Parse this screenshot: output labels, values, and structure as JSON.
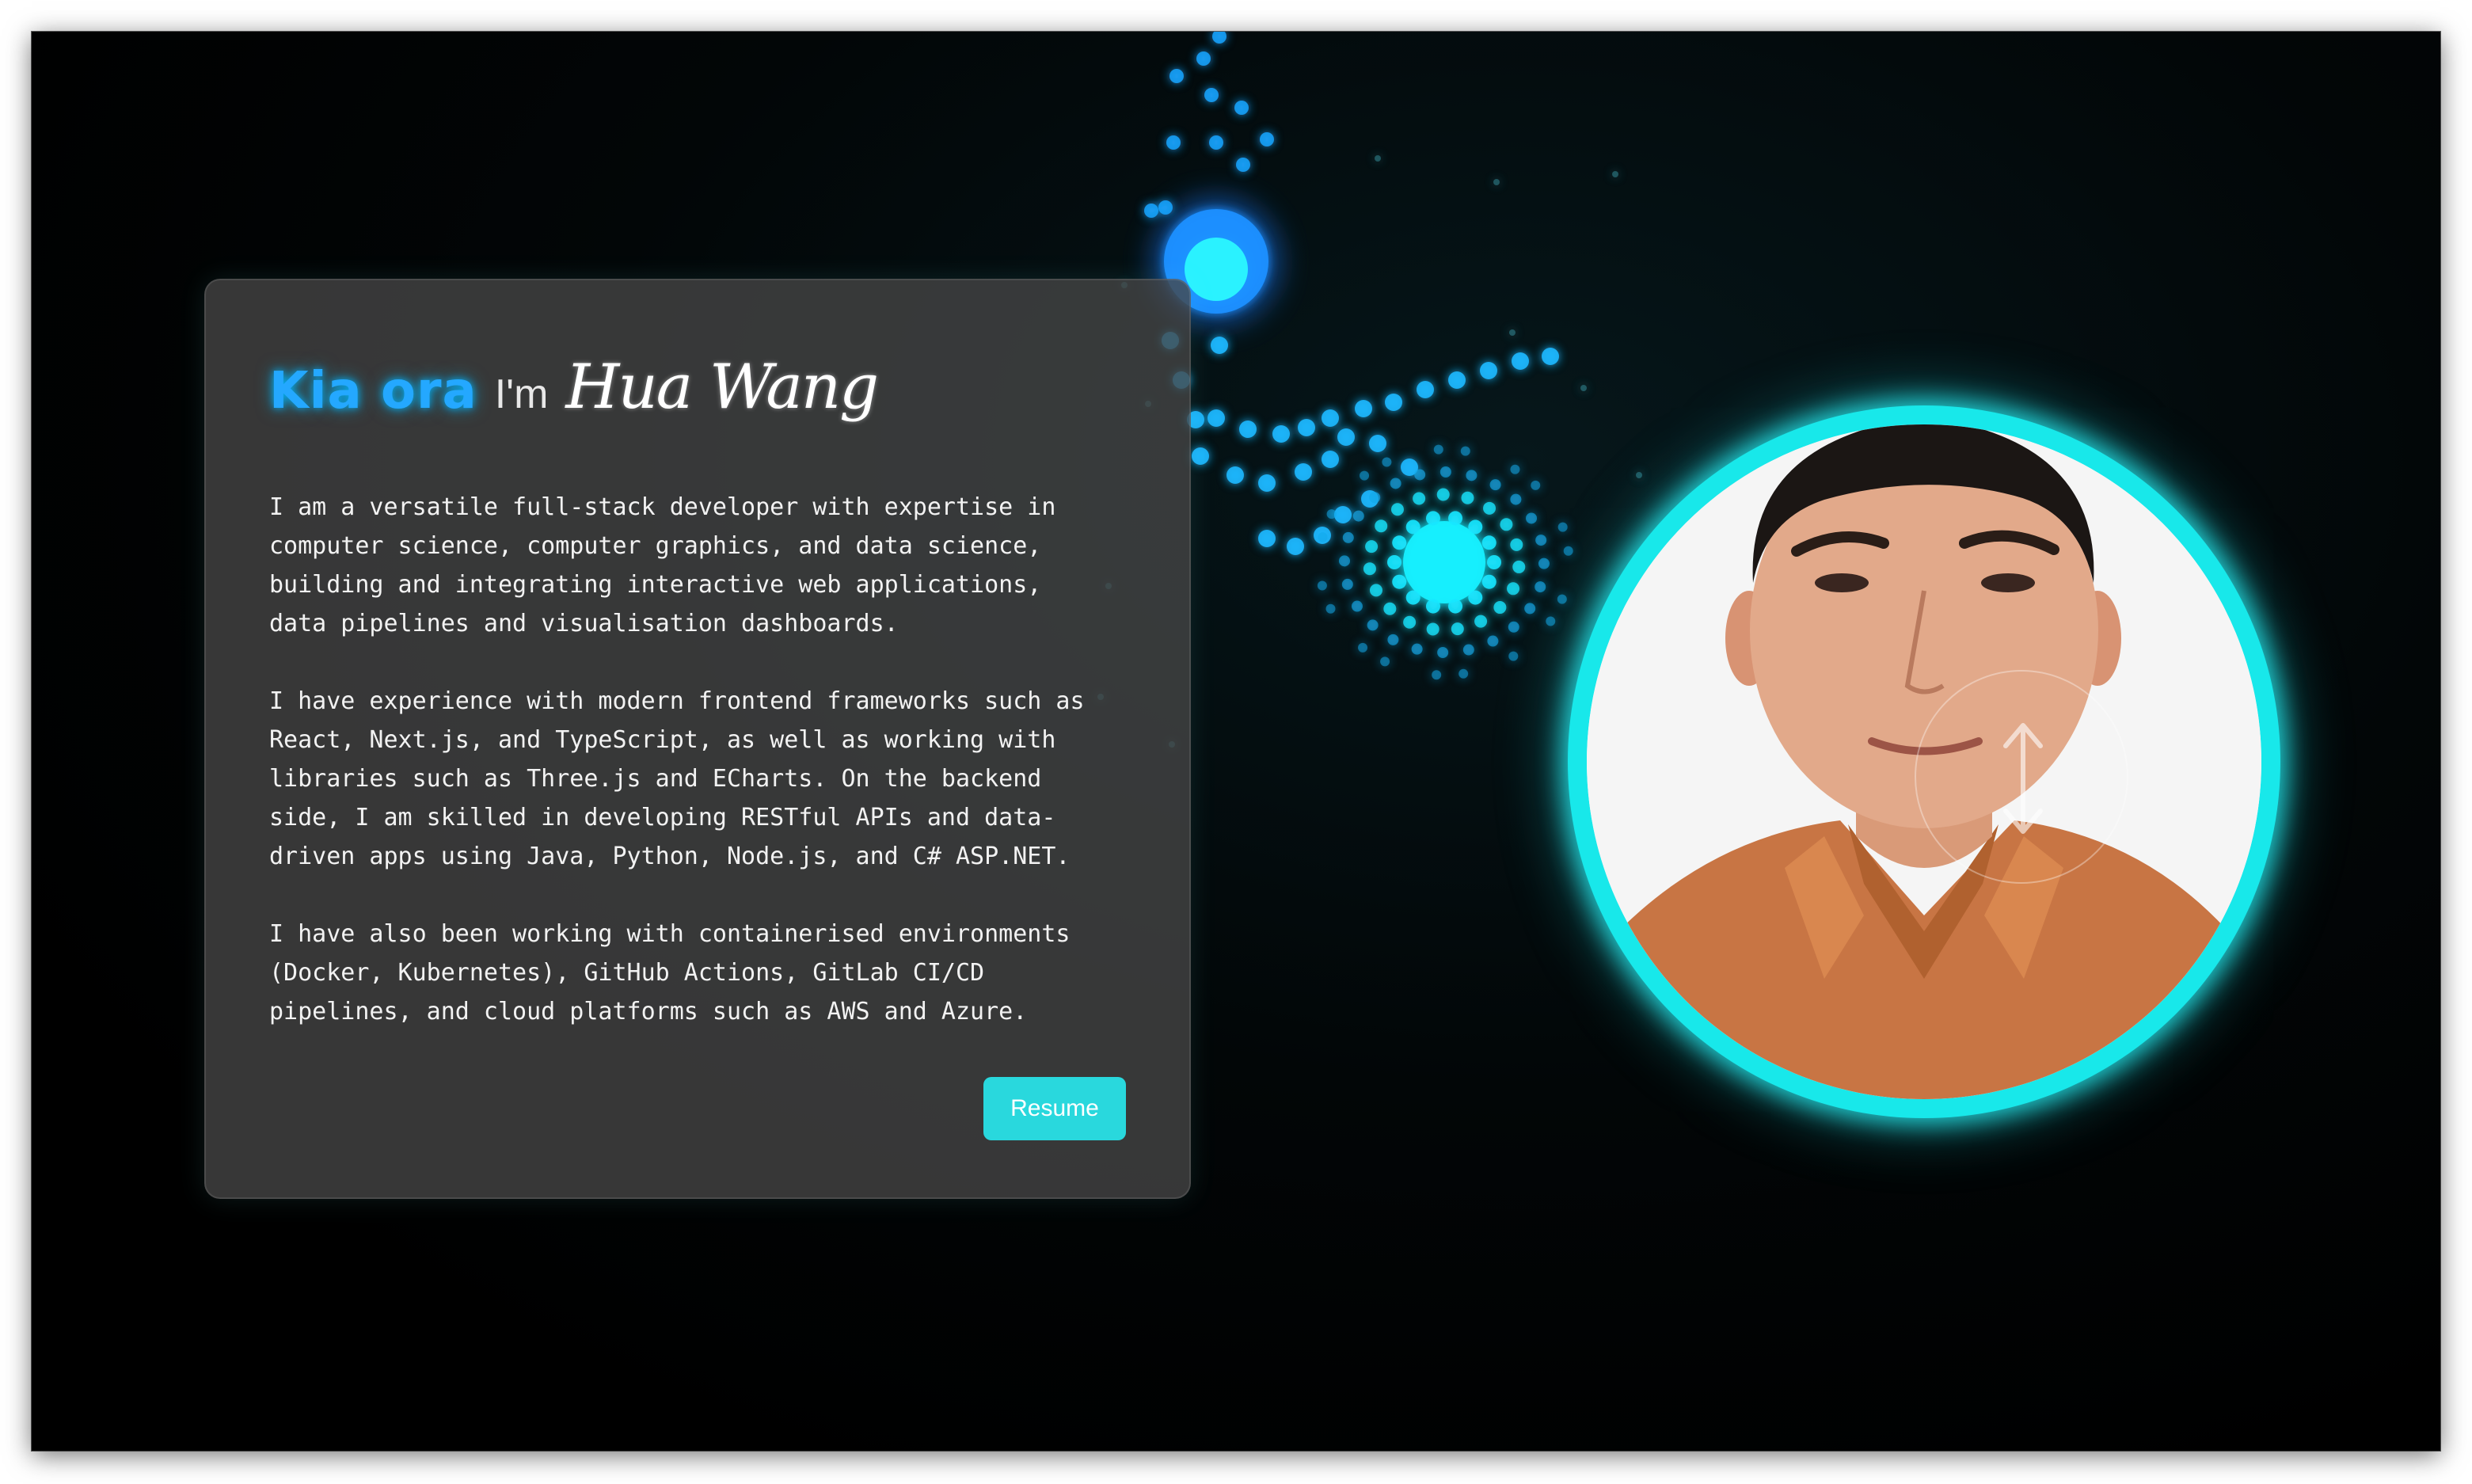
{
  "greeting": {
    "hello": "Kia ora",
    "intro": "I'm",
    "name": "Hua Wang"
  },
  "bio": {
    "paragraph1": "I am a versatile full-stack developer with expertise in\ncomputer science, computer graphics, and data science,\nbuilding and integrating interactive web applications,\ndata pipelines and visualisation dashboards.",
    "paragraph2": "I have experience with modern frontend frameworks such as\nReact, Next.js, and TypeScript, as well as working with\nlibraries such as Three.js and ECharts. On the backend\nside, I am skilled in developing RESTful APIs and data-\ndriven apps using Java, Python, Node.js, and C# ASP.NET.",
    "paragraph3": "I have also been working with containerised environments\n(Docker, Kubernetes), GitHub Actions, GitLab CI/CD\npipelines, and cloud platforms such as AWS and Azure."
  },
  "buttons": {
    "resume": "Resume"
  },
  "colors": {
    "accent": "#29d8dd",
    "glow": "#18e8ea",
    "greeting": "#24a8ff",
    "background": "#000000",
    "shirt": "#c87544"
  },
  "icons": {
    "resize": "vertical-resize-arrows-icon"
  }
}
